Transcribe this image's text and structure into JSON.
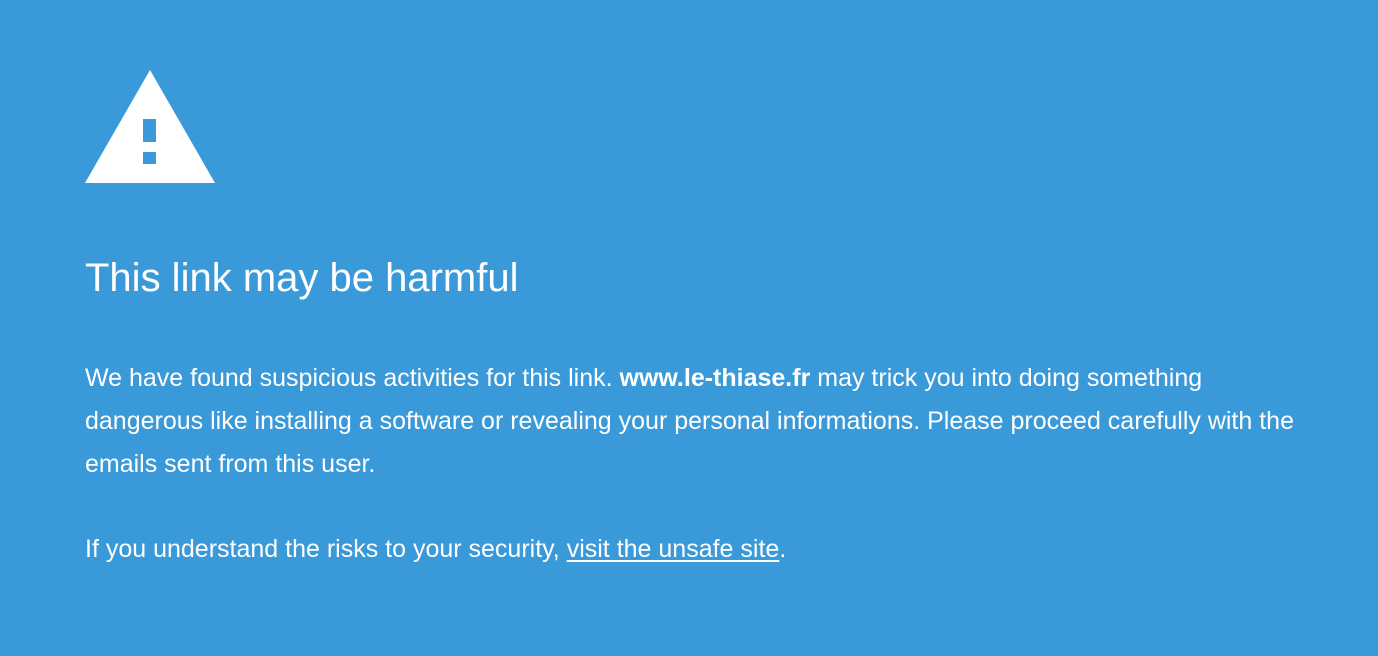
{
  "icon": "warning-triangle-icon",
  "colors": {
    "background": "#3a9ad9",
    "text": "#ffffff"
  },
  "title": "This link may be harmful",
  "message": {
    "before_domain": "We have found suspicious activities for this link. ",
    "domain": "www.le-thiase.fr",
    "after_domain": " may trick you into doing something dangerous like installing a software or revealing your personal informations. Please proceed carefully with the emails sent from this user."
  },
  "risk": {
    "prefix": "If you understand the risks to your security, ",
    "link_text": "visit the unsafe site",
    "suffix": "."
  }
}
